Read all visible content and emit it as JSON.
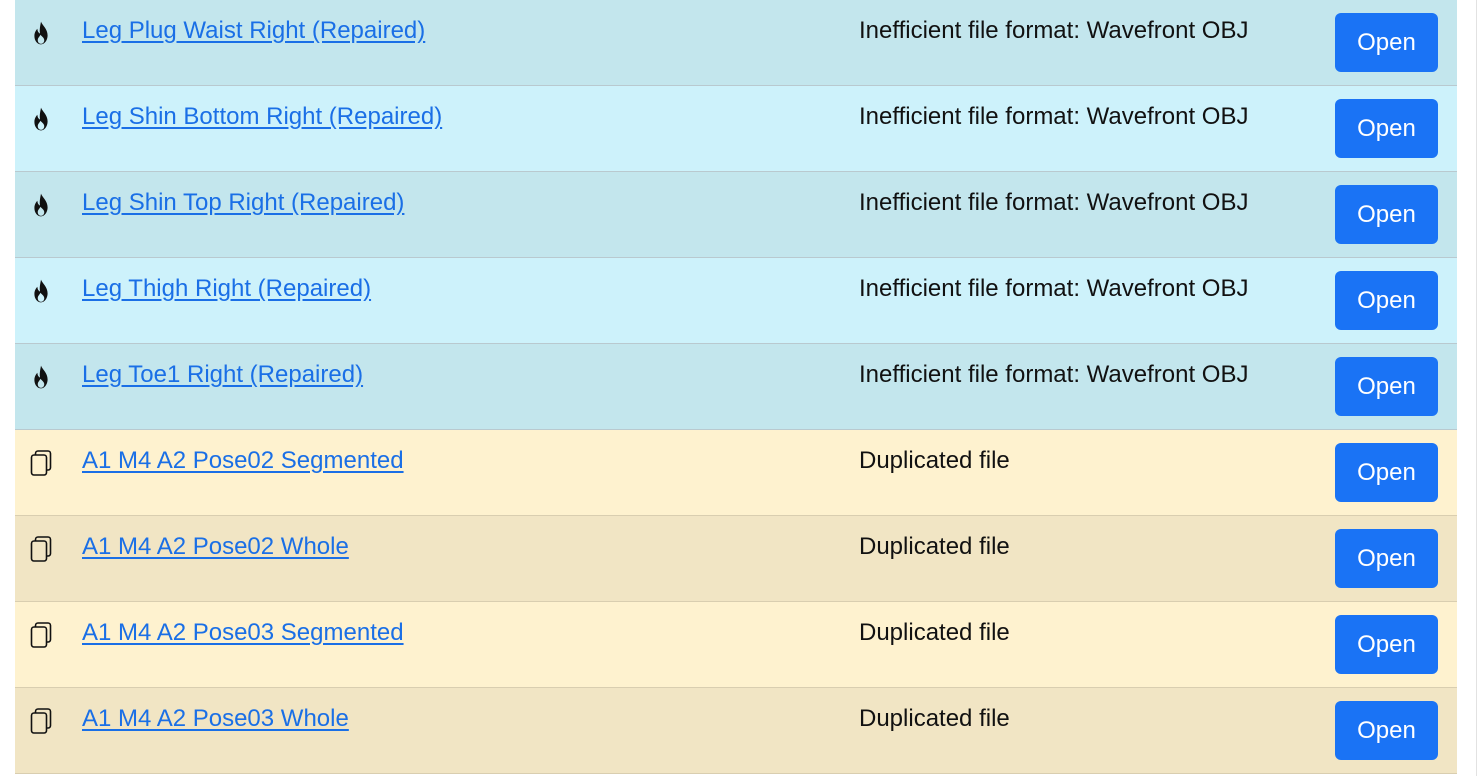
{
  "colors": {
    "info_a": "#c3e6ed",
    "info_b": "#cdf2fb",
    "warn_a": "#fef2cf",
    "warn_b": "#f1e5c4",
    "link": "#1a6fe6",
    "button": "#1a73f5"
  },
  "rows": [
    {
      "icon": "fire-icon",
      "name": "Leg Plug Waist Right (Repaired)",
      "reason": "Inefficient file format: Wavefront OBJ",
      "button": "Open"
    },
    {
      "icon": "fire-icon",
      "name": "Leg Shin Bottom Right (Repaired)",
      "reason": "Inefficient file format: Wavefront OBJ",
      "button": "Open"
    },
    {
      "icon": "fire-icon",
      "name": "Leg Shin Top Right (Repaired)",
      "reason": "Inefficient file format: Wavefront OBJ",
      "button": "Open"
    },
    {
      "icon": "fire-icon",
      "name": "Leg Thigh Right (Repaired)",
      "reason": "Inefficient file format: Wavefront OBJ",
      "button": "Open"
    },
    {
      "icon": "fire-icon",
      "name": "Leg Toe1 Right (Repaired)",
      "reason": "Inefficient file format: Wavefront OBJ",
      "button": "Open"
    },
    {
      "icon": "copy-icon",
      "name": "A1 M4 A2 Pose02 Segmented",
      "reason": "Duplicated file",
      "button": "Open"
    },
    {
      "icon": "copy-icon",
      "name": "A1 M4 A2 Pose02 Whole",
      "reason": "Duplicated file",
      "button": "Open"
    },
    {
      "icon": "copy-icon",
      "name": "A1 M4 A2 Pose03 Segmented",
      "reason": "Duplicated file",
      "button": "Open"
    },
    {
      "icon": "copy-icon",
      "name": "A1 M4 A2 Pose03 Whole",
      "reason": "Duplicated file",
      "button": "Open"
    }
  ]
}
